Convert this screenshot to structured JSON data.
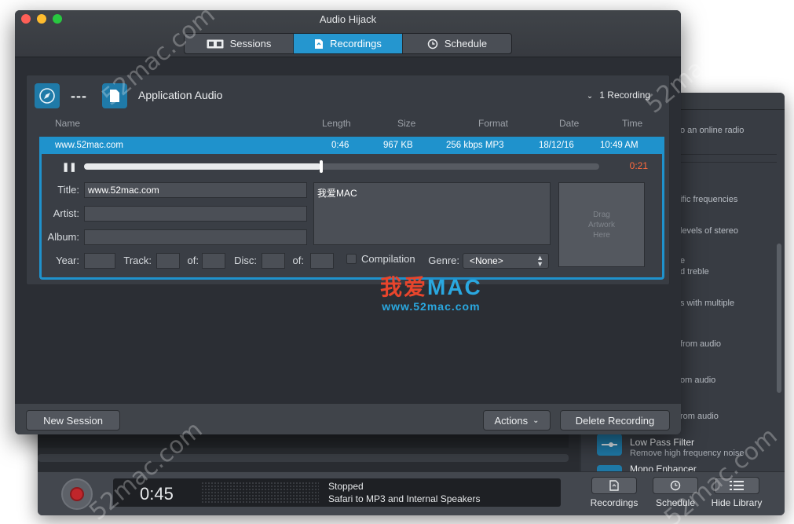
{
  "window": {
    "title": "Audio Hijack"
  },
  "tabs": [
    {
      "label": "Sessions",
      "icon": "sessions-icon"
    },
    {
      "label": "Recordings",
      "icon": "recording-file-icon",
      "active": true
    },
    {
      "label": "Schedule",
      "icon": "clock-icon"
    }
  ],
  "session": {
    "name": "Application Audio",
    "dash": "---",
    "recording_count": "1 Recording"
  },
  "columns": {
    "name": "Name",
    "length": "Length",
    "size": "Size",
    "format": "Format",
    "date": "Date",
    "time": "Time"
  },
  "recording": {
    "name": "www.52mac.com",
    "length": "0:46",
    "size": "967 KB",
    "format": "256 kbps MP3",
    "date": "18/12/16",
    "time": "10:49 AM",
    "remaining": "0:21",
    "progress": 0.46
  },
  "editor": {
    "labels": {
      "title": "Title:",
      "artist": "Artist:",
      "album": "Album:",
      "year": "Year:",
      "track": "Track:",
      "of": "of:",
      "disc": "Disc:",
      "of2": "of:",
      "compilation": "Compilation",
      "genre": "Genre:"
    },
    "values": {
      "title": "www.52mac.com",
      "artist": "",
      "album": "",
      "notes": "我爱MAC",
      "genre": "<None>"
    },
    "artwork_placeholder": "Drag\nArtwork\nHere"
  },
  "footer": {
    "new_session": "New Session",
    "actions": "Actions",
    "delete_recording": "Delete Recording"
  },
  "library": {
    "items": [
      {
        "desc": "o an online radio"
      },
      {
        "desc": "ific frequencies"
      },
      {
        "desc": "levels of stereo"
      },
      {
        "desc": "e"
      },
      {
        "desc": "d treble"
      },
      {
        "desc": "s with multiple"
      },
      {
        "desc": "from audio"
      },
      {
        "desc": "om audio"
      },
      {
        "desc": "rom audio"
      }
    ],
    "low_pass": {
      "name": "Low Pass Filter",
      "sub": "Remove high frequency noise"
    },
    "next_name": "Mono Enhancer"
  },
  "transport": {
    "time": "0:45",
    "status": "Stopped",
    "route": "Safari to MP3 and Internal Speakers",
    "buttons": {
      "recordings": "Recordings",
      "schedule": "Schedule",
      "hide_library": "Hide Library"
    }
  },
  "watermark": {
    "text": "52mac.com",
    "logo_cn": "我爱",
    "logo_en": "MAC",
    "logo_url": "www.52mac.com"
  },
  "colors": {
    "accent": "#1f92cc",
    "record": "#c0262b",
    "remaining": "#ff6a3d"
  }
}
